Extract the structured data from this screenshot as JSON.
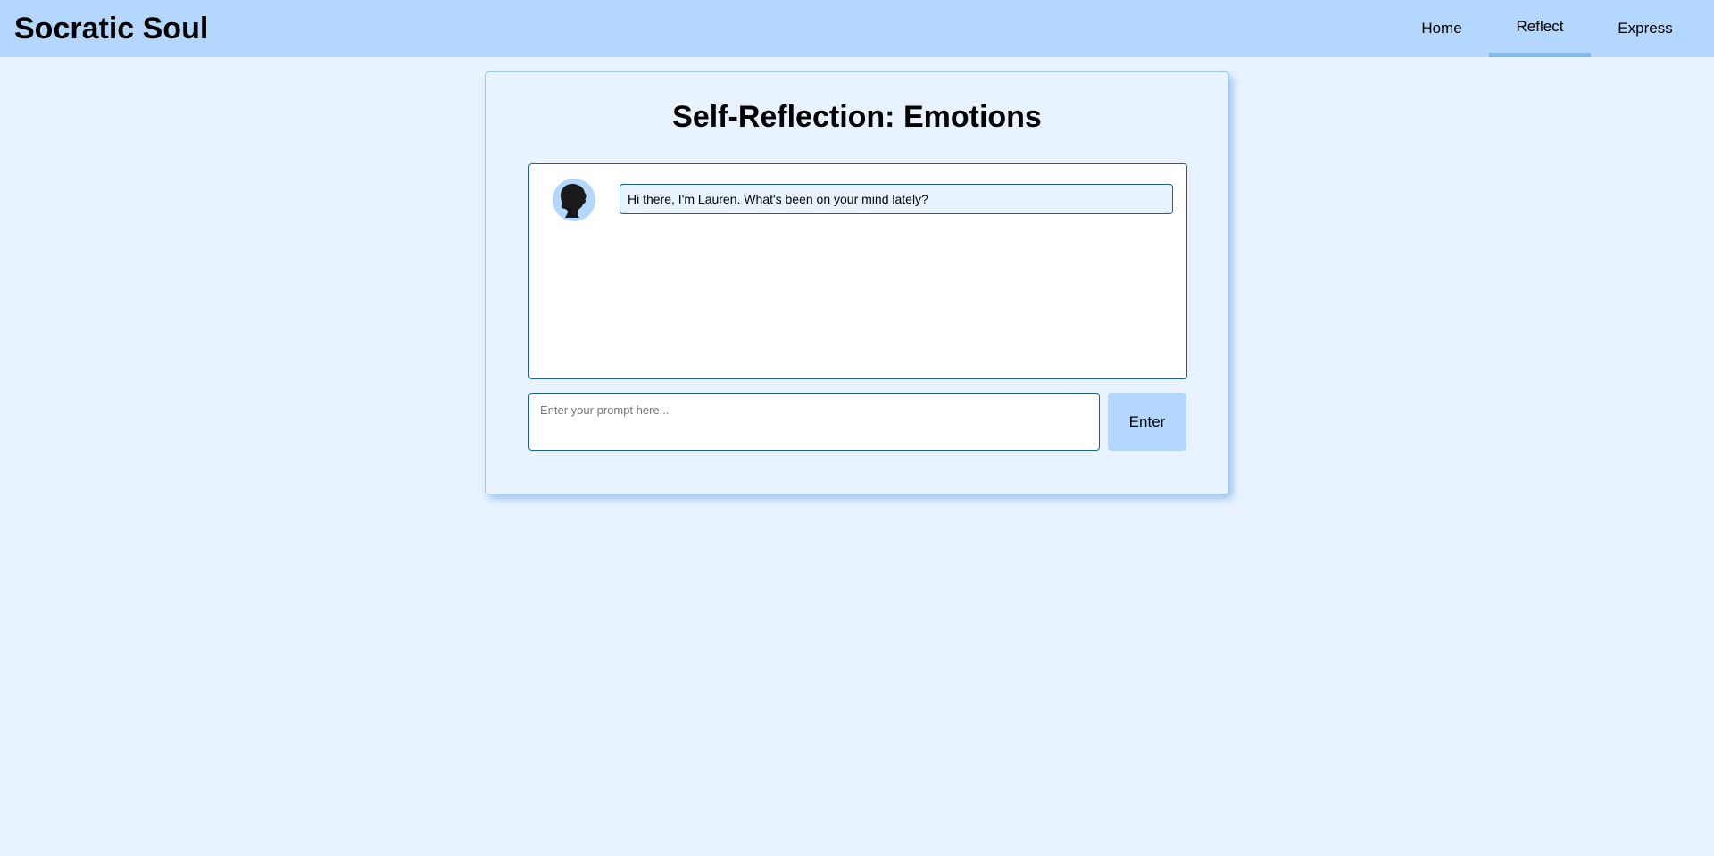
{
  "brand": {
    "title": "Socratic Soul"
  },
  "nav": {
    "items": [
      {
        "label": "Home",
        "active": false
      },
      {
        "label": "Reflect",
        "active": true
      },
      {
        "label": "Express",
        "active": false
      }
    ]
  },
  "page": {
    "title": "Self-Reflection: Emotions"
  },
  "chat": {
    "messages": [
      {
        "sender_icon": "woman-silhouette-icon",
        "text": "Hi there, I'm Lauren. What's been on your mind lately?"
      }
    ]
  },
  "composer": {
    "placeholder": "Enter your prompt here...",
    "value": "",
    "submit_label": "Enter"
  },
  "colors": {
    "page_background": "#e9f3ff",
    "navbar_background": "#b3d7fe",
    "active_tab_underline": "#7fbbea",
    "border": "#1f5f8e",
    "button_background": "#b3d7fe"
  }
}
